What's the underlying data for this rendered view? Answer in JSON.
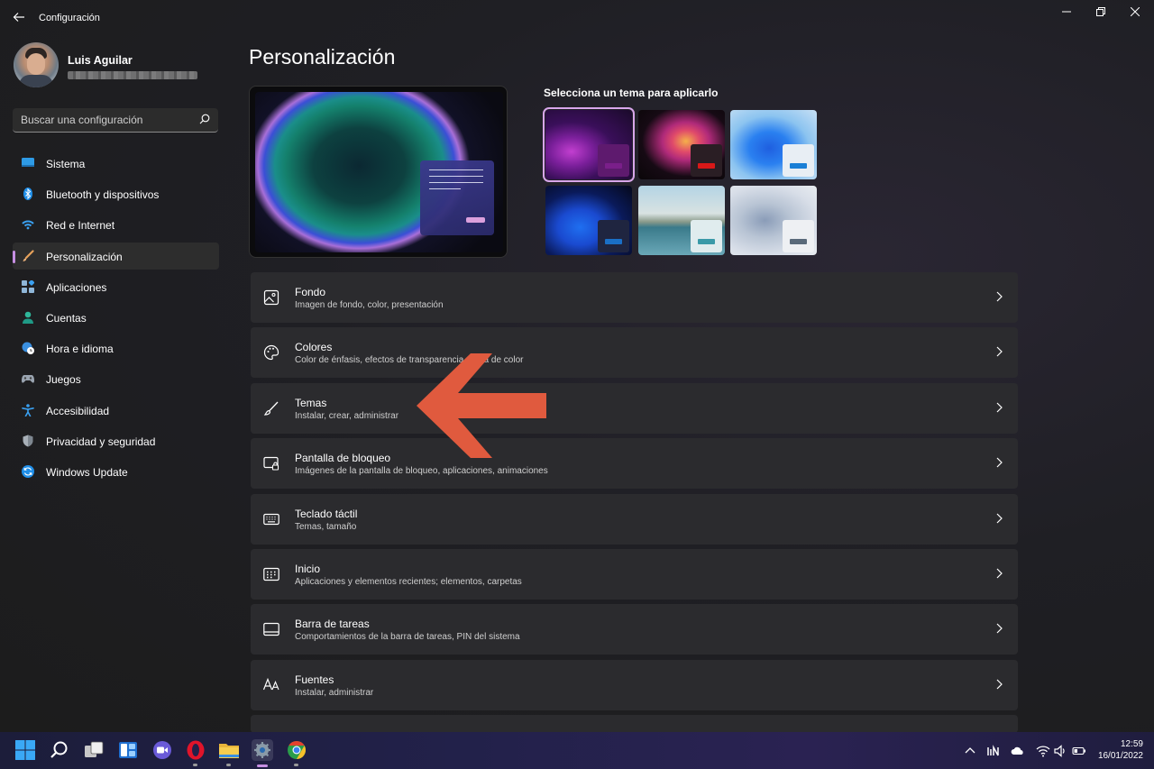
{
  "window": {
    "title": "Configuración",
    "back_icon": "arrow-left-icon",
    "controls": [
      "minimize-icon",
      "maximize-icon",
      "close-icon"
    ]
  },
  "profile": {
    "name": "Luis Aguilar",
    "email_redacted": true
  },
  "search": {
    "placeholder": "Buscar una configuración",
    "icon": "search-icon"
  },
  "sidebar": {
    "items": [
      {
        "label": "Sistema",
        "icon": "monitor-icon",
        "selected": false
      },
      {
        "label": "Bluetooth y dispositivos",
        "icon": "bluetooth-icon",
        "selected": false
      },
      {
        "label": "Red e Internet",
        "icon": "wifi-icon",
        "selected": false
      },
      {
        "label": "Personalización",
        "icon": "brush-icon",
        "selected": true
      },
      {
        "label": "Aplicaciones",
        "icon": "apps-icon",
        "selected": false
      },
      {
        "label": "Cuentas",
        "icon": "person-icon",
        "selected": false
      },
      {
        "label": "Hora e idioma",
        "icon": "globe-clock-icon",
        "selected": false
      },
      {
        "label": "Juegos",
        "icon": "gamepad-icon",
        "selected": false
      },
      {
        "label": "Accesibilidad",
        "icon": "accessibility-icon",
        "selected": false
      },
      {
        "label": "Privacidad y seguridad",
        "icon": "shield-icon",
        "selected": false
      },
      {
        "label": "Windows Update",
        "icon": "update-icon",
        "selected": false
      }
    ]
  },
  "main": {
    "title": "Personalización",
    "themes_label": "Selecciona un tema para aplicarlo",
    "themes": [
      {
        "name": "purple-bloom",
        "selected": true,
        "accent": "#7a1f8a"
      },
      {
        "name": "colorful-flower",
        "selected": false,
        "accent": "#d81818"
      },
      {
        "name": "blue-bloom-light",
        "selected": false,
        "accent": "#1a7fd6"
      },
      {
        "name": "blue-bloom-dark",
        "selected": false,
        "accent": "#1a6fc6"
      },
      {
        "name": "lake-landscape",
        "selected": false,
        "accent": "#3a9aa8"
      },
      {
        "name": "silver-bloom",
        "selected": false,
        "accent": "#5a6a7a"
      }
    ],
    "cards": [
      {
        "title": "Fondo",
        "desc": "Imagen de fondo, color, presentación",
        "icon": "image-icon"
      },
      {
        "title": "Colores",
        "desc": "Color de énfasis, efectos de transparencia, tema de color",
        "icon": "palette-icon"
      },
      {
        "title": "Temas",
        "desc": "Instalar, crear, administrar",
        "icon": "brush-icon"
      },
      {
        "title": "Pantalla de bloqueo",
        "desc": "Imágenes de la pantalla de bloqueo, aplicaciones, animaciones",
        "icon": "lock-screen-icon"
      },
      {
        "title": "Teclado táctil",
        "desc": "Temas, tamaño",
        "icon": "keyboard-icon"
      },
      {
        "title": "Inicio",
        "desc": "Aplicaciones y elementos recientes; elementos, carpetas",
        "icon": "start-icon"
      },
      {
        "title": "Barra de tareas",
        "desc": "Comportamientos de la barra de tareas, PIN del sistema",
        "icon": "taskbar-icon"
      },
      {
        "title": "Fuentes",
        "desc": "Instalar, administrar",
        "icon": "font-icon"
      }
    ]
  },
  "annotation": {
    "color": "#e05a3e",
    "direction": "left",
    "target": "Temas"
  },
  "taskbar": {
    "apps": [
      "windows-start-icon",
      "search-icon",
      "task-view-icon",
      "widgets-icon",
      "teams-chat-icon",
      "opera-icon",
      "file-explorer-icon",
      "settings-icon",
      "chrome-icon"
    ],
    "tray": [
      "chevron-up-icon",
      "signal-icon",
      "onedrive-icon",
      "wifi-icon",
      "volume-icon",
      "battery-icon"
    ],
    "time": "12:59",
    "date": "16/01/2022"
  },
  "colors": {
    "accent": "#c68fe3",
    "card_bg": "#2b2b2e",
    "window_bg": "#1c1c1c"
  }
}
